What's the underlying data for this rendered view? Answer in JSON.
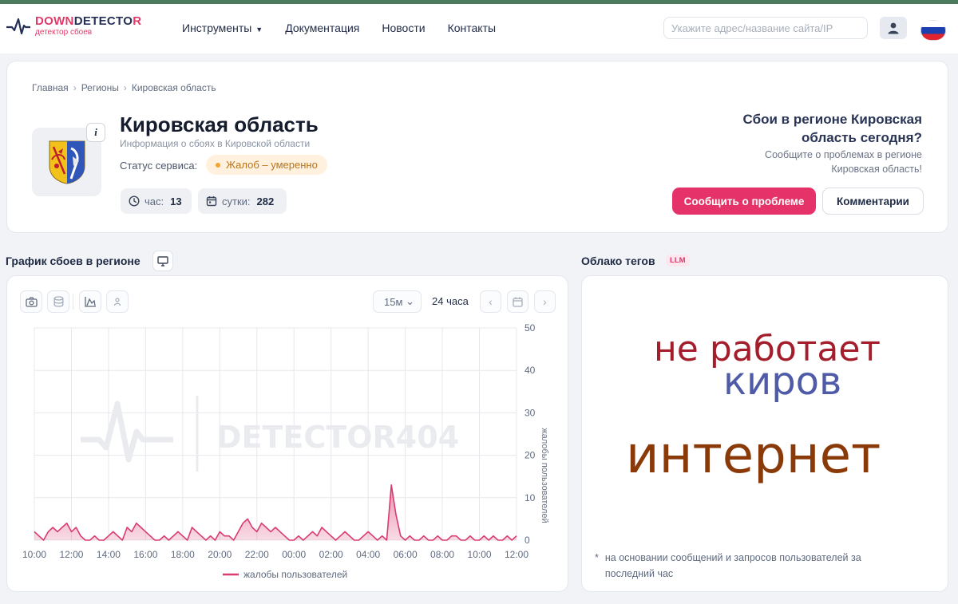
{
  "header": {
    "logo": {
      "part1": "DOWN",
      "part2": "DETECTO",
      "part3": "R",
      "subtitle": "детектор сбоев"
    },
    "nav": [
      {
        "label": "Инструменты",
        "has_dropdown": true
      },
      {
        "label": "Документация"
      },
      {
        "label": "Новости"
      },
      {
        "label": "Контакты"
      }
    ],
    "search_placeholder": "Укажите адрес/название сайта/IP"
  },
  "region": {
    "breadcrumb": [
      "Главная",
      "Регионы",
      "Кировская область"
    ],
    "title": "Кировская область",
    "subtitle": "Информация о сбоях в Кировской области",
    "status_label": "Статус сервиса:",
    "status_value": "Жалоб – умеренно",
    "stats": {
      "hour_label": "час:",
      "hour_value": "13",
      "day_label": "сутки:",
      "day_value": "282"
    },
    "cta_title": "Сбои в регионе Кировская область сегодня?",
    "cta_text": "Сообщите о проблемах в регионе Кировская область!",
    "report_button": "Сообщить о проблеме",
    "comments_button": "Комментарии",
    "info_symbol": "i"
  },
  "chart_section": {
    "title": "График сбоев в регионе",
    "interval": "15м",
    "range": "24 часа"
  },
  "cloud_section": {
    "title": "Облако тегов",
    "badge": "LLM",
    "tags": [
      "не работает",
      "киров",
      "интернет"
    ],
    "footnote_mark": "*",
    "footnote": "на основании сообщений и запросов пользователей за последний час"
  },
  "colors": {
    "accent": "#e5336a",
    "series": "#d93b6e",
    "status_bg": "#fff1de",
    "status_text": "#b7751d"
  },
  "icons": [
    "camera-icon",
    "database-icon",
    "area-chart-icon",
    "user-icon",
    "calendar-icon",
    "clock-icon",
    "chevron-left-icon",
    "chevron-right-icon",
    "monitor-icon"
  ],
  "chart_data": {
    "type": "area",
    "ylabel": "жалобы пользователей",
    "ylim": [
      0,
      50
    ],
    "y_ticks": [
      0,
      10,
      20,
      30,
      40,
      50
    ],
    "x_ticks": [
      "10:00",
      "12:00",
      "14:00",
      "16:00",
      "18:00",
      "20:00",
      "22:00",
      "00:00",
      "02:00",
      "04:00",
      "06:00",
      "08:00",
      "10:00",
      "12:00"
    ],
    "watermark": "DETECTOR404",
    "legend_position": "bottom",
    "grid": true,
    "series": [
      {
        "name": "жалобы пользователей",
        "x_hours": [
          0,
          0.25,
          0.5,
          0.75,
          1,
          1.25,
          1.5,
          1.75,
          2,
          2.25,
          2.5,
          2.75,
          3,
          3.25,
          3.5,
          3.75,
          4,
          4.25,
          4.5,
          4.75,
          5,
          5.25,
          5.5,
          5.75,
          6,
          6.25,
          6.5,
          6.75,
          7,
          7.25,
          7.5,
          7.75,
          8,
          8.25,
          8.5,
          8.75,
          9,
          9.25,
          9.5,
          9.75,
          10,
          10.25,
          10.5,
          10.75,
          11,
          11.25,
          11.5,
          11.75,
          12,
          12.25,
          12.5,
          12.75,
          13,
          13.25,
          13.5,
          13.75,
          14,
          14.25,
          14.5,
          14.75,
          15,
          15.25,
          15.5,
          15.75,
          16,
          16.25,
          16.5,
          16.75,
          17,
          17.25,
          17.5,
          17.75,
          18,
          18.25,
          18.5,
          18.75,
          19,
          19.25,
          19.5,
          19.75,
          20,
          20.25,
          20.5,
          20.75,
          21,
          21.25,
          21.5,
          21.75,
          22,
          22.25,
          22.5,
          22.75,
          23,
          23.25,
          23.5,
          23.75,
          24,
          24.25,
          24.5,
          24.75,
          25,
          25.25,
          25.5,
          25.75,
          26
        ],
        "values": [
          2,
          1,
          0,
          2,
          3,
          2,
          3,
          4,
          2,
          3,
          1,
          0,
          0,
          1,
          0,
          0,
          1,
          2,
          1,
          0,
          3,
          2,
          4,
          3,
          2,
          1,
          0,
          0,
          1,
          0,
          1,
          2,
          1,
          0,
          3,
          2,
          1,
          0,
          1,
          0,
          2,
          1,
          1,
          0,
          2,
          4,
          5,
          3,
          2,
          4,
          3,
          2,
          3,
          2,
          1,
          0,
          0,
          1,
          0,
          1,
          2,
          1,
          3,
          2,
          1,
          0,
          1,
          2,
          1,
          0,
          0,
          1,
          2,
          1,
          0,
          1,
          0,
          13,
          6,
          1,
          0,
          1,
          0,
          0,
          1,
          0,
          0,
          1,
          0,
          0,
          1,
          1,
          0,
          0,
          1,
          0,
          0,
          1,
          0,
          1,
          0,
          0,
          1,
          0,
          1
        ]
      }
    ]
  }
}
